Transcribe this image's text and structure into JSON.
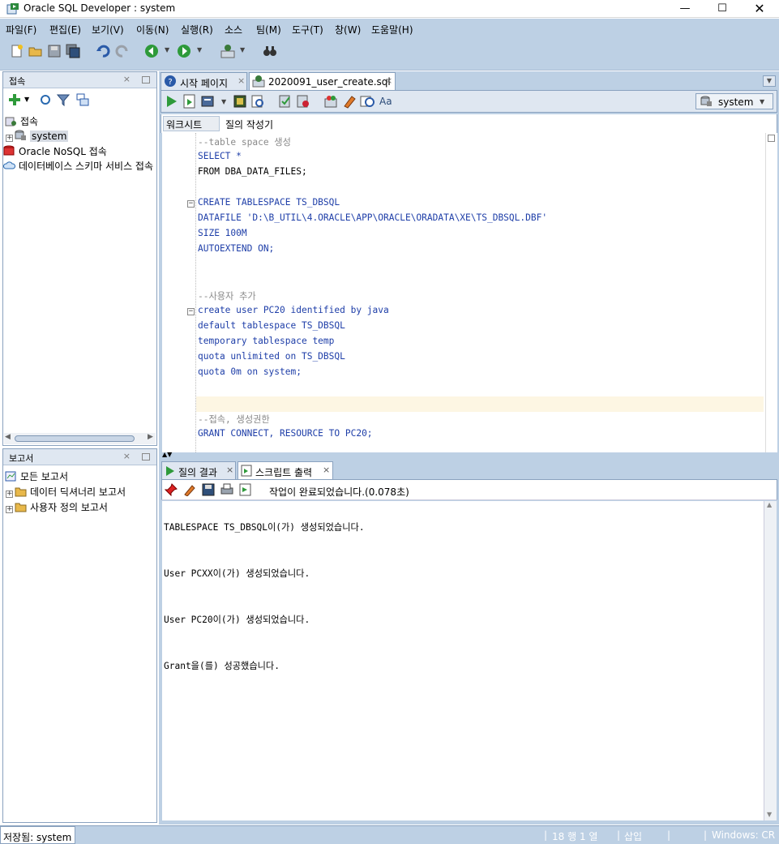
{
  "window": {
    "title": "Oracle SQL Developer : system"
  },
  "menu": [
    "파일(F)",
    "편집(E)",
    "보기(V)",
    "이동(N)",
    "실행(R)",
    "소스",
    "팀(M)",
    "도구(T)",
    "창(W)",
    "도움말(H)"
  ],
  "connections_panel": {
    "title": "접속",
    "tree": {
      "root": "접속",
      "system": "system",
      "nosql": "Oracle NoSQL 접속",
      "cloud": "데이터베이스 스키마 서비스 접속"
    }
  },
  "reports_panel": {
    "title": "보고서",
    "items": [
      "모든 보고서",
      "데이터 딕셔너리 보고서",
      "사용자 정의 보고서"
    ]
  },
  "editor": {
    "tabs": [
      "시작 페이지",
      "2020091_user_create.sql"
    ],
    "connection": "system",
    "subtabs": [
      "워크시트",
      "질의 작성기"
    ],
    "lines": [
      "--table space 생성",
      "SELECT *",
      "FROM DBA_DATA_FILES;",
      "",
      "CREATE TABLESPACE TS_DBSQL",
      "DATAFILE 'D:\\B_UTIL\\4.ORACLE\\APP\\ORACLE\\ORADATA\\XE\\TS_DBSQL.DBF'",
      "SIZE 100M",
      "AUTOEXTEND ON;",
      "",
      "",
      "--사용자 추가",
      "create user PC20 identified by java",
      "default tablespace TS_DBSQL",
      "temporary tablespace temp",
      "quota unlimited on TS_DBSQL",
      "quota 0m on system;",
      "",
      "",
      "--접속, 생성권한",
      "GRANT CONNECT, RESOURCE TO PC20;"
    ]
  },
  "output": {
    "tabs": [
      "질의 결과",
      "스크립트 출력"
    ],
    "message": "작업이 완료되었습니다.(0.078초)",
    "lines": [
      "TABLESPACE TS_DBSQL이(가) 생성되었습니다.",
      "User PCXX이(가) 생성되었습니다.",
      "User PC20이(가) 생성되었습니다.",
      "Grant을(를) 성공했습니다."
    ]
  },
  "status": {
    "saved": "저장됨: system",
    "position": "18 행 1 열",
    "mode": "삽입",
    "platform": "Windows: CR"
  },
  "colors": {
    "chrome": "#bdd0e4",
    "keyword": "#1e3ea8",
    "comment": "#8a8a8a",
    "current_line": "#fdf6e3"
  }
}
